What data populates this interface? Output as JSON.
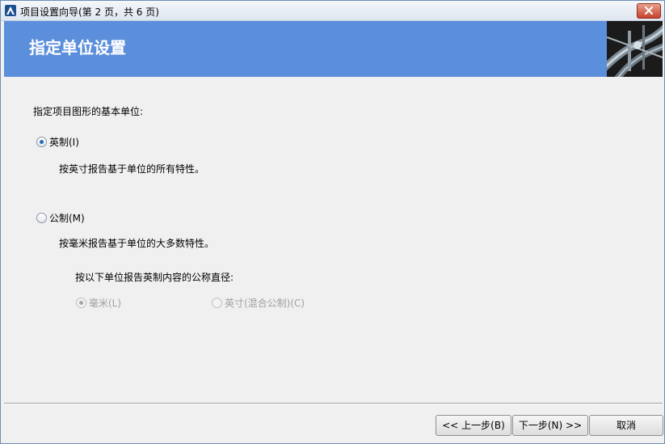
{
  "window": {
    "title": "项目设置向导(第 2 页，共 6 页)"
  },
  "header": {
    "title": "指定单位设置"
  },
  "main": {
    "prompt": "指定项目图形的基本单位:",
    "imperial": {
      "label": "英制(I)",
      "selected": true,
      "description": "按英寸报告基于单位的所有特性。"
    },
    "metric": {
      "label": "公制(M)",
      "selected": false,
      "description": "按毫米报告基于单位的大多数特性。",
      "sub_prompt": "按以下单位报告英制内容的公称直径:",
      "options": [
        {
          "label": "毫米(L)",
          "selected": true,
          "enabled": false
        },
        {
          "label": "英寸(混合公制)(C)",
          "selected": false,
          "enabled": false
        }
      ]
    }
  },
  "footer": {
    "back_label": "<< 上一步(B)",
    "next_label": "下一步(N) >>",
    "cancel_label": "取消"
  },
  "colors": {
    "header_bg": "#5b8fdb",
    "accent": "#2a6ac0"
  }
}
